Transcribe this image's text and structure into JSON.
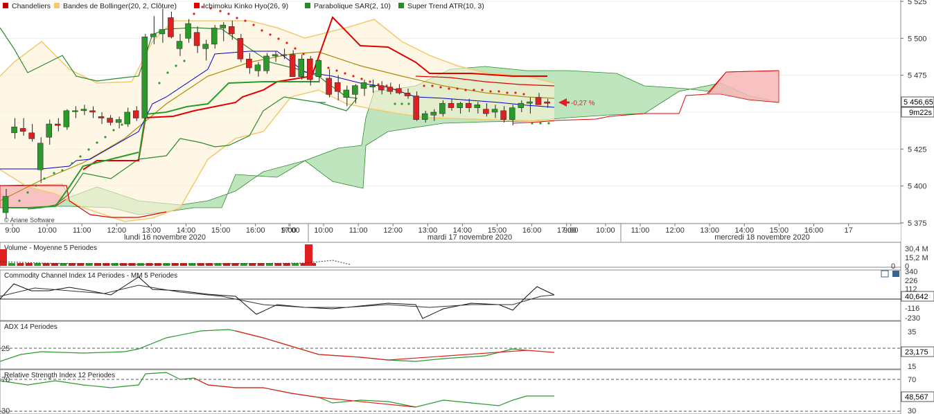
{
  "legend": [
    {
      "label": "Chandeliers",
      "color": "#c00000"
    },
    {
      "label": "Bandes de Bollinger(20, 2, Clôture)",
      "color": "#f4c96b"
    },
    {
      "label": "Ichimoku Kinko Hyo(26, 9)",
      "color": "#e00000"
    },
    {
      "label": "Parabolique SAR(2, 10)",
      "color": "#2a8a2a"
    },
    {
      "label": "Super Trend ATR(10, 3)",
      "color": "#2a8a2a"
    }
  ],
  "watermark": "© Ariane Software",
  "last_price": {
    "value": "5 456,65",
    "timer": "9m22s",
    "change": "-0,27 %"
  },
  "colors": {
    "up": "#2a9a2a",
    "down": "#e02020",
    "bollinger": "#f4c96b",
    "kijun": "#b08a00",
    "cloud_green": "#a8dca8",
    "cloud_red": "#f7b7b7",
    "tenkan": "#0000cc"
  },
  "date_labels": [
    "lundi 16 novembre 2020",
    "mardi 17 novembre 2020",
    "mercredi 18 novembre 2020"
  ],
  "subpanels": {
    "volume": {
      "title": "Volume  - Moyenne 5 Periodes",
      "ticks": [
        "30,4 M",
        "15,2 M",
        "0"
      ],
      "ticks_right": [
        "0"
      ]
    },
    "cci": {
      "title": "Commodity Channel Index 14 Periodes - MM  5 Periodes",
      "ticks": [
        "340",
        "226",
        "112",
        "-116",
        "-230"
      ],
      "current": "40,642"
    },
    "adx": {
      "title": "ADX 14 Periodes",
      "ticks": [
        "35",
        "25",
        "15"
      ],
      "left_tick": "25",
      "current": "23,175"
    },
    "rsi": {
      "title": "Relative Strength Index 12 Periodes",
      "ticks": [
        "70",
        "30"
      ],
      "left_ticks": [
        "70",
        "30"
      ],
      "current": "48,567"
    }
  },
  "chart_data": {
    "type": "candlestick",
    "title": "",
    "ylim": [
      5375,
      5525
    ],
    "y_ticks": [
      5525,
      5500,
      5475,
      5450,
      5425,
      5400,
      5375
    ],
    "y_tick_labels": [
      "5 525",
      "5 500",
      "5 475",
      "5 450",
      "5 425",
      "5 400",
      "5 375"
    ],
    "x_tick_labels": [
      "9:00",
      "10:00",
      "11:00",
      "12:00",
      "13:00",
      "14:00",
      "15:00",
      "16:00",
      "17:00",
      "9:00",
      "10:00",
      "11:00",
      "12:00",
      "13:00",
      "14:00",
      "15:00",
      "16:00",
      "17:00",
      "9:00",
      "10:00",
      "11:00",
      "12:00",
      "13:00",
      "14:00",
      "15:00",
      "16:00",
      "17"
    ],
    "candles": [
      [
        5382,
        5398,
        5378,
        5393
      ],
      [
        5436,
        5446,
        5432,
        5440
      ],
      [
        5439,
        5446,
        5434,
        5437
      ],
      [
        5436,
        5442,
        5430,
        5432
      ],
      [
        5411,
        5433,
        5402,
        5429
      ],
      [
        5433,
        5445,
        5428,
        5442
      ],
      [
        5442,
        5446,
        5437,
        5441
      ],
      [
        5440,
        5452,
        5438,
        5451
      ],
      [
        5451,
        5454,
        5446,
        5451
      ],
      [
        5451,
        5455,
        5448,
        5452
      ],
      [
        5451,
        5454,
        5446,
        5450
      ],
      [
        5447,
        5450,
        5442,
        5446
      ],
      [
        5446,
        5448,
        5441,
        5443
      ],
      [
        5443,
        5447,
        5439,
        5445
      ],
      [
        5442,
        5453,
        5440,
        5450
      ],
      [
        5451,
        5454,
        5444,
        5446
      ],
      [
        5446,
        5503,
        5444,
        5501
      ],
      [
        5501,
        5515,
        5496,
        5503
      ],
      [
        5503,
        5520,
        5497,
        5506
      ],
      [
        5514,
        5518,
        5500,
        5501
      ],
      [
        5493,
        5503,
        5488,
        5498
      ],
      [
        5500,
        5513,
        5497,
        5510
      ],
      [
        5504,
        5508,
        5490,
        5495
      ],
      [
        5493,
        5499,
        5485,
        5496
      ],
      [
        5496,
        5509,
        5493,
        5507
      ],
      [
        5507,
        5511,
        5498,
        5509
      ],
      [
        5508,
        5512,
        5499,
        5503
      ],
      [
        5500,
        5503,
        5484,
        5486
      ],
      [
        5486,
        5490,
        5476,
        5480
      ],
      [
        5478,
        5484,
        5474,
        5482
      ],
      [
        5478,
        5490,
        5476,
        5488
      ],
      [
        5488,
        5491,
        5484,
        5489
      ],
      [
        5489,
        5493,
        5486,
        5489
      ],
      [
        5489,
        5492,
        5474,
        5474
      ],
      [
        5474,
        5489,
        5472,
        5486
      ],
      [
        5486,
        5488,
        5468,
        5472
      ],
      [
        5474,
        5486,
        5470,
        5485
      ],
      [
        5473,
        5479,
        5460,
        5462
      ],
      [
        5470,
        5475,
        5458,
        5464
      ],
      [
        5460,
        5468,
        5454,
        5465
      ],
      [
        5462,
        5469,
        5456,
        5468
      ],
      [
        5466,
        5472,
        5461,
        5470
      ],
      [
        5467,
        5472,
        5463,
        5468
      ],
      [
        5468,
        5471,
        5462,
        5465
      ],
      [
        5467,
        5470,
        5462,
        5464
      ],
      [
        5466,
        5469,
        5462,
        5463
      ],
      [
        5463,
        5466,
        5459,
        5461
      ],
      [
        5461,
        5464,
        5444,
        5445
      ],
      [
        5445,
        5451,
        5443,
        5449
      ],
      [
        5448,
        5452,
        5444,
        5450
      ],
      [
        5449,
        5458,
        5447,
        5456
      ],
      [
        5456,
        5459,
        5451,
        5453
      ],
      [
        5453,
        5457,
        5449,
        5456
      ],
      [
        5456,
        5459,
        5450,
        5453
      ],
      [
        5453,
        5457,
        5449,
        5455
      ],
      [
        5452,
        5456,
        5447,
        5449
      ],
      [
        5450,
        5455,
        5446,
        5452
      ],
      [
        5451,
        5454,
        5443,
        5445
      ],
      [
        5445,
        5455,
        5441,
        5453
      ],
      [
        5453,
        5458,
        5450,
        5456
      ],
      [
        5456,
        5460,
        5449,
        5457
      ],
      [
        5460,
        5463,
        5455,
        5455
      ],
      [
        5457,
        5459,
        5453,
        5456
      ]
    ]
  }
}
